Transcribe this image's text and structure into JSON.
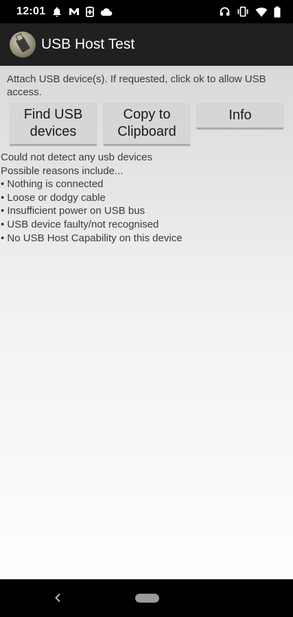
{
  "status_bar": {
    "time": "12:01",
    "left_icons": [
      "notification-bell-icon",
      "email-icon",
      "battery-saver-icon",
      "cloud-icon"
    ],
    "right_icons": [
      "headphones-icon",
      "vibrate-icon",
      "wifi-icon",
      "battery-icon"
    ]
  },
  "app_bar": {
    "title": "USB Host Test",
    "icon": "usb-plug-icon"
  },
  "instructions": "Attach USB device(s).  If requested, click ok to allow USB access.",
  "buttons": {
    "find": "Find USB\ndevices",
    "copy": "Copy to\nClipboard",
    "info": "Info"
  },
  "messages": [
    "Could not detect any usb devices",
    "Possible reasons include...",
    "• Nothing is connected",
    "• Loose or dodgy cable",
    "• Insufficient power on USB bus",
    "• USB device faulty/not recognised",
    "• No USB Host Capability on this device"
  ],
  "nav_bar": {
    "back_icon": "back-chevron-icon",
    "home_icon": "home-pill-icon"
  },
  "colors": {
    "status_bar": "#000000",
    "app_bar": "#202020",
    "button": "#d6d6d6",
    "text": "#3a3a3a"
  }
}
